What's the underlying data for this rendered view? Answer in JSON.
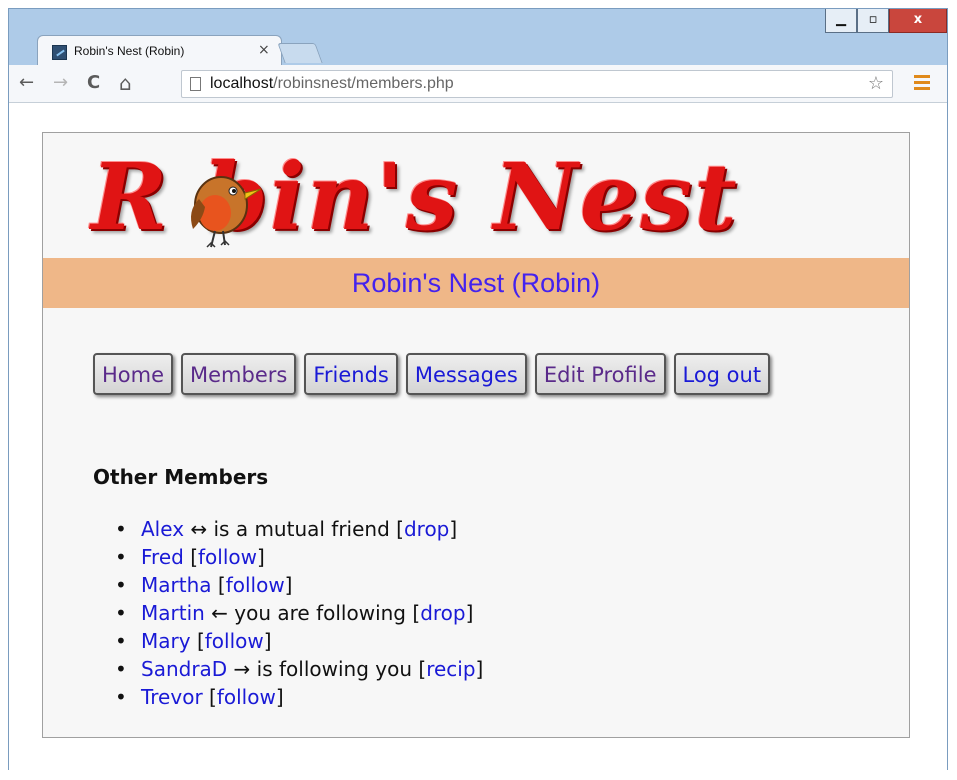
{
  "browser": {
    "tab_title": "Robin's Nest (Robin)",
    "tab_close": "×",
    "window_controls": {
      "minimize": "▁",
      "maximize": "▫",
      "close": "x"
    },
    "nav": {
      "back": "←",
      "forward": "→",
      "reload": "C",
      "home": "⌂"
    },
    "url_host": "localhost",
    "url_path": "/robinsnest/members.php",
    "star": "☆"
  },
  "site": {
    "logo_text": "R  bin's Nest",
    "banner": "Robin's Nest (Robin)",
    "menu": [
      {
        "label": "Home"
      },
      {
        "label": "Members"
      },
      {
        "label": "Friends"
      },
      {
        "label": "Messages"
      },
      {
        "label": "Edit Profile"
      },
      {
        "label": "Log out"
      }
    ],
    "section_title": "Other Members",
    "members": [
      {
        "name": "Alex",
        "status": " ↔ is a mutual friend ",
        "action": "drop"
      },
      {
        "name": "Fred",
        "status": " ",
        "action": "follow"
      },
      {
        "name": "Martha",
        "status": " ",
        "action": "follow"
      },
      {
        "name": "Martin",
        "status": " ← you are following ",
        "action": "drop"
      },
      {
        "name": "Mary",
        "status": " ",
        "action": "follow"
      },
      {
        "name": "SandraD",
        "status": " → is following you ",
        "action": "recip"
      },
      {
        "name": "Trevor",
        "status": " ",
        "action": "follow"
      }
    ]
  },
  "colors": {
    "link": "#1a1ad6",
    "visited": "#5a2a8a",
    "banner_bg": "#efb788",
    "banner_text": "#4422ee",
    "logo_red": "#e01414"
  }
}
